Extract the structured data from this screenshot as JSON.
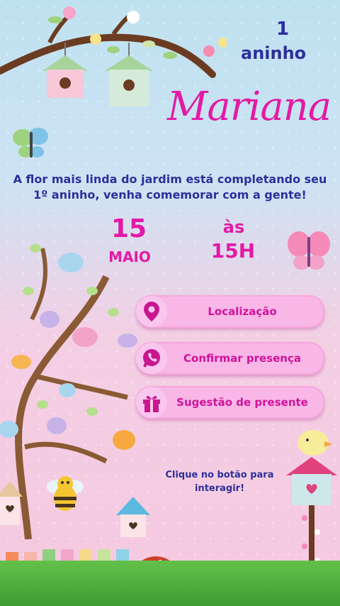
{
  "age": {
    "number": "1",
    "word": "aninho"
  },
  "name": "Mariana",
  "message": "A flor mais linda do jardim está completando seu 1º aninho, venha comemorar com a gente!",
  "date": {
    "day": "15",
    "month": "MAIO"
  },
  "time": {
    "prefix": "às",
    "hour": "15H"
  },
  "buttons": [
    {
      "label": "Localização",
      "icon": "location-pin-icon"
    },
    {
      "label": "Confirmar presença",
      "icon": "whatsapp-icon"
    },
    {
      "label": "Sugestão de presente",
      "icon": "gift-icon"
    }
  ],
  "hint": "Clique no botão para interagir!",
  "colors": {
    "accent": "#e31aa5",
    "text": "#2c2f9b",
    "button": "#f8b7e7"
  }
}
